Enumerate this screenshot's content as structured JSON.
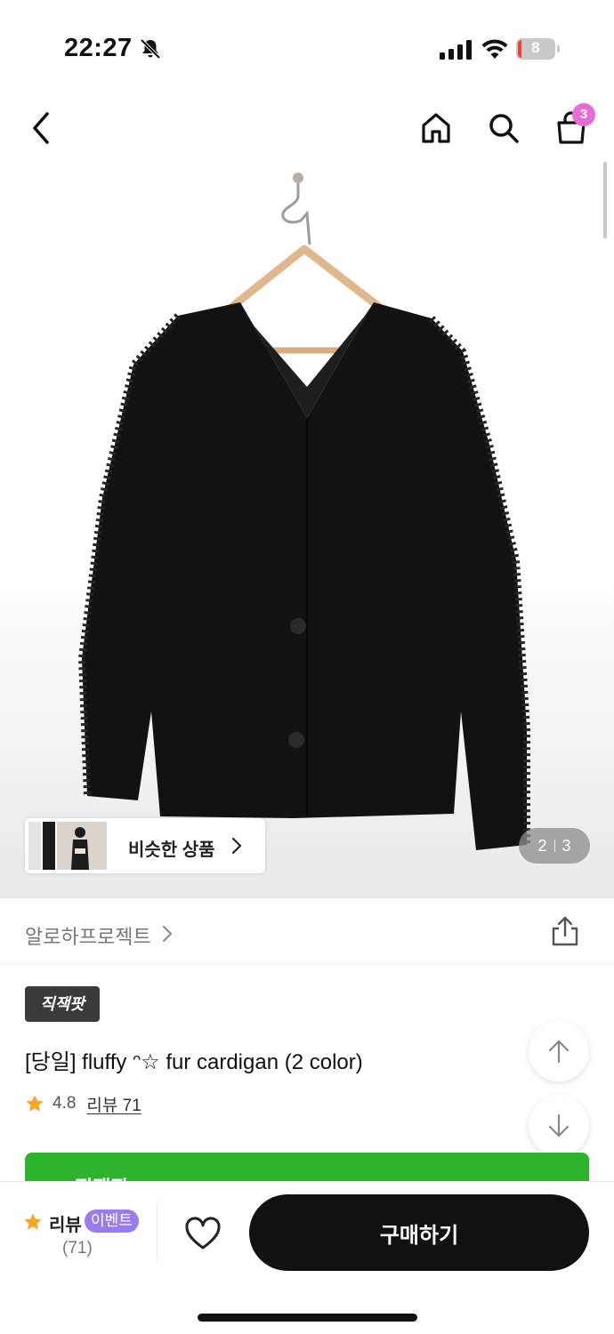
{
  "status": {
    "time": "22:27",
    "battery": "8"
  },
  "nav": {
    "cart_count": "3"
  },
  "gallery": {
    "similar_label": "비슷한 상품",
    "page_current": "2",
    "page_total": "3"
  },
  "store": {
    "name": "알로하프로젝트"
  },
  "product": {
    "tag": "직잭팟",
    "title": "[당일] fluffy ᵔ☆ fur cardigan (2 color)",
    "rating": "4.8",
    "review_link": "리뷰 71",
    "banner_text": "직잭팟 >"
  },
  "bottom_bar": {
    "review_label": "리뷰",
    "event_badge": "이벤트",
    "review_count": "(71)",
    "buy_label": "구매하기"
  },
  "colors": {
    "accent_green": "#2db32d",
    "badge_pink": "#e86bd6",
    "event_purple": "#9b7cf0",
    "star": "#f5a623"
  },
  "icons": [
    "muted-bell-icon",
    "signal-icon",
    "wifi-icon",
    "battery-icon",
    "back-icon",
    "home-icon",
    "search-icon",
    "cart-icon",
    "chevron-right-icon",
    "share-icon",
    "star-icon",
    "arrow-up-icon",
    "arrow-down-icon",
    "heart-icon"
  ]
}
